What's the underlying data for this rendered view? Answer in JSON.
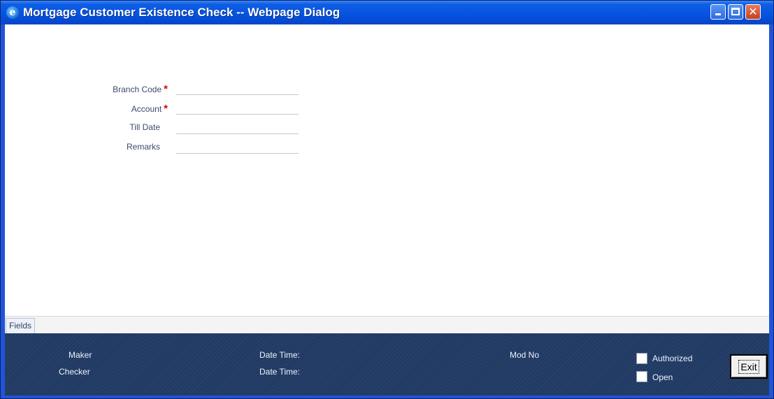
{
  "window": {
    "title": "Mortgage Customer Existence Check -- Webpage Dialog",
    "icon": "ie-icon",
    "controls": {
      "minimize": "minimize-icon",
      "maximize": "maximize-icon",
      "close": "✕"
    }
  },
  "form": {
    "fields": [
      {
        "label": "Branch Code",
        "required": true,
        "value": ""
      },
      {
        "label": "Account",
        "required": true,
        "value": ""
      },
      {
        "label": "Till Date",
        "required": false,
        "value": ""
      },
      {
        "label": "Remarks",
        "required": false,
        "value": ""
      }
    ],
    "required_marker": "*"
  },
  "tabs": [
    {
      "label": "Fields",
      "active": true
    }
  ],
  "footer": {
    "maker_label": "Maker",
    "checker_label": "Checker",
    "maker_datetime_label": "Date Time:",
    "checker_datetime_label": "Date Time:",
    "mod_no_label": "Mod No",
    "authorized_label": "Authorized",
    "open_label": "Open",
    "exit_label": "Exit"
  },
  "colors": {
    "titlebar": "#0553e0",
    "footer": "#213a63",
    "label": "#3c4a6b",
    "required": "#e00000"
  }
}
